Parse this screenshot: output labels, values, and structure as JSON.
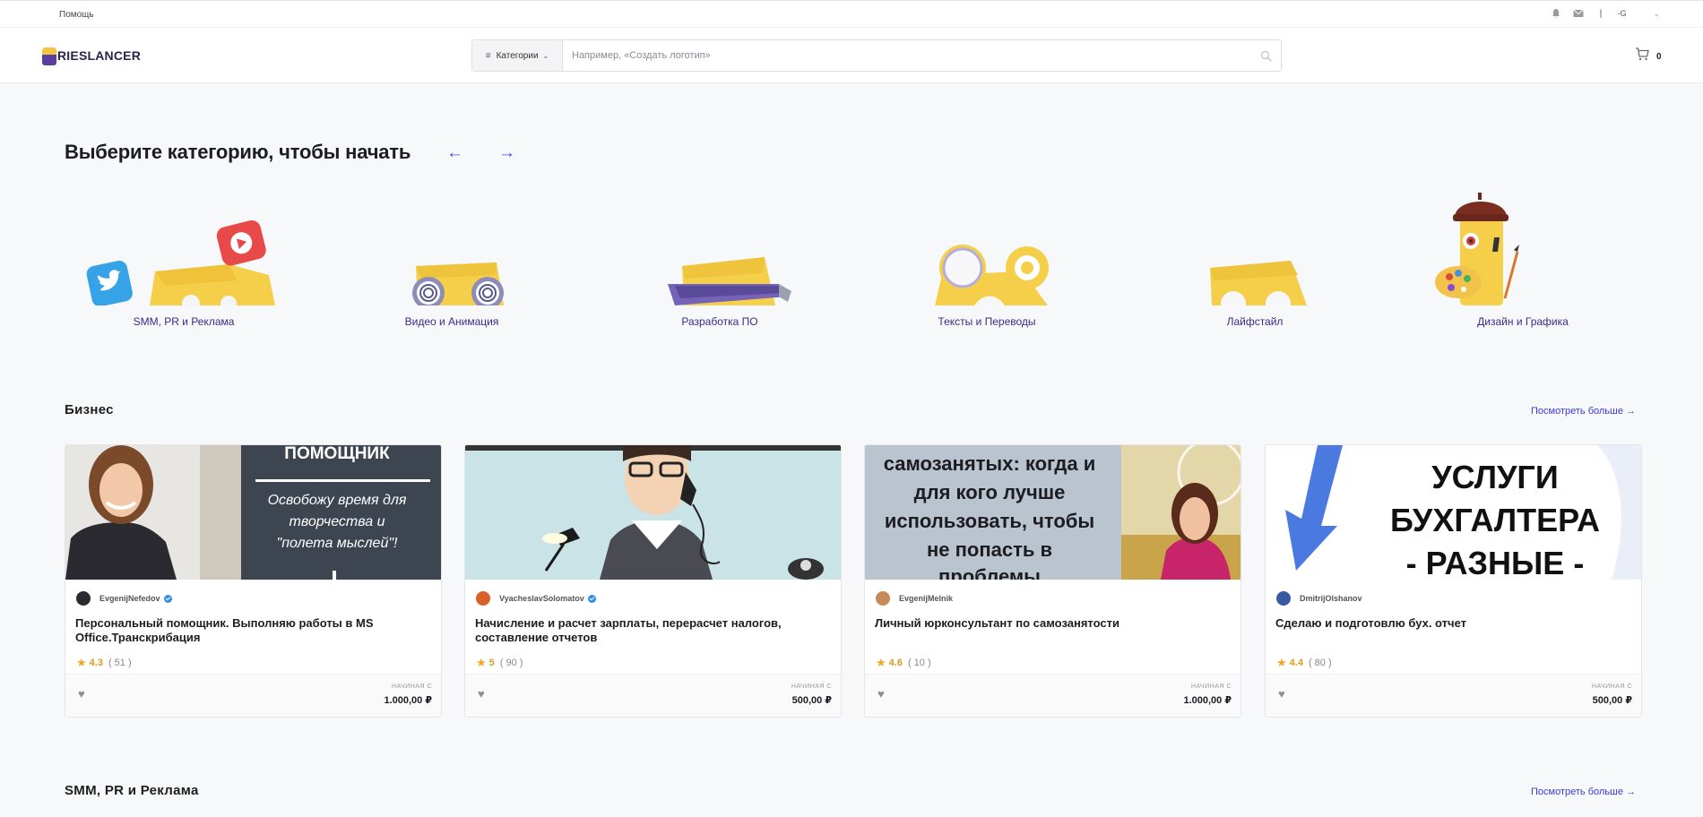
{
  "topbar": {
    "help": "Помощь",
    "icons": [
      "bell-icon",
      "mail-icon",
      "info-icon"
    ],
    "lang": "-G"
  },
  "header": {
    "logo_text": "RIESLANCER",
    "search": {
      "category_button": "Категории",
      "placeholder": "Например, «Создать логотип»"
    },
    "cart_count": "0"
  },
  "categories": {
    "heading": "Выберите категорию, чтобы начать",
    "items": [
      {
        "label": "SMM, PR и Реклама"
      },
      {
        "label": "Видео и Анимация"
      },
      {
        "label": "Разработка ПО"
      },
      {
        "label": "Тексты и Переводы"
      },
      {
        "label": "Лайфстайл"
      },
      {
        "label": "Дизайн и Графика"
      }
    ]
  },
  "sections": [
    {
      "title": "Бизнес",
      "see_more": "Посмотреть больше →",
      "cards": [
        {
          "seller": "EvgenijNefedov",
          "verified": true,
          "title": "Персональный помощник. Выполняю работы в MS Office.Транскрибация",
          "rating": "4.3",
          "reviews": "( 51 )",
          "from_label": "НАЧИНАЯ С",
          "price": "1.000,00 ₽",
          "thumb_text": [
            "ПОМОЩНИК",
            "Освобожу время для творчества и \"полета мыслей\"!"
          ]
        },
        {
          "seller": "VyacheslavSolomatov",
          "verified": true,
          "title": "Начисление и расчет зарплаты, перерасчет налогов, составление отчетов",
          "rating": "5",
          "reviews": "( 90 )",
          "from_label": "НАЧИНАЯ С",
          "price": "500,00 ₽"
        },
        {
          "seller": "EvgenijMelnik",
          "verified": false,
          "title": "Личный юрконсультант по самозанятости",
          "rating": "4.6",
          "reviews": "( 10 )",
          "from_label": "НАЧИНАЯ С",
          "price": "1.000,00 ₽",
          "thumb_text": [
            "самозанятых: когда и для кого лучше использовать, чтобы не попасть в проблемы"
          ]
        },
        {
          "seller": "DmitrijOlshanov",
          "verified": false,
          "title": "Сделаю и подготовлю бух. отчет",
          "rating": "4.4",
          "reviews": "( 80 )",
          "from_label": "НАЧИНАЯ С",
          "price": "500,00 ₽",
          "thumb_text": [
            "УСЛУГИ",
            "БУХГАЛТЕРА",
            "- РАЗНЫЕ -"
          ]
        }
      ]
    },
    {
      "title": "SMM, PR и Реклама",
      "see_more": "Посмотреть больше →"
    }
  ],
  "colors": {
    "accent": "#3a3ad6",
    "brand_yellow": "#f5c542",
    "brand_purple": "#5a3fa0",
    "star": "#f5a623"
  }
}
